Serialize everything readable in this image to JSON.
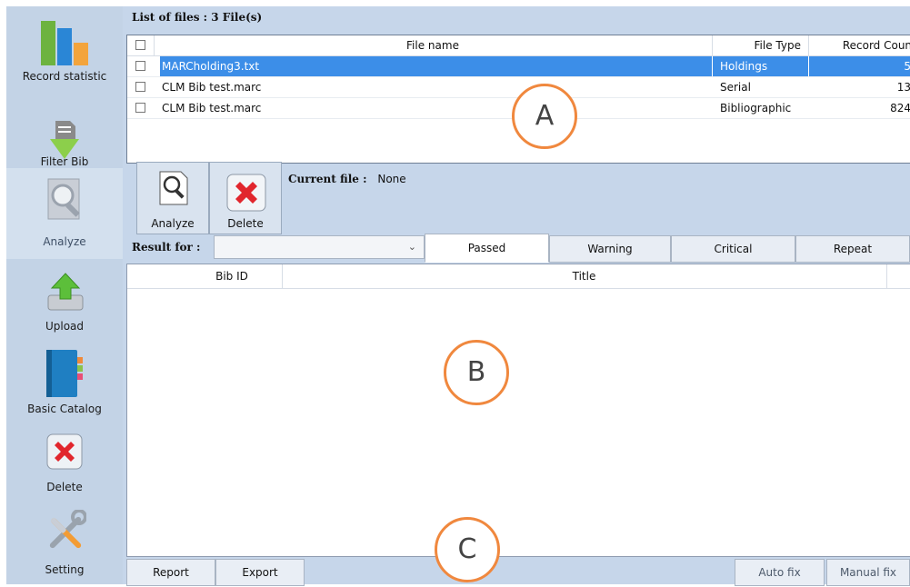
{
  "sidebar": {
    "items": [
      {
        "label": "Record statistic",
        "icon": "bar-chart-icon"
      },
      {
        "label": "Filter Bib",
        "icon": "filter-download-icon"
      },
      {
        "label": "Analyze",
        "icon": "magnifier-icon"
      },
      {
        "label": "Upload",
        "icon": "upload-icon"
      },
      {
        "label": "Basic Catalog",
        "icon": "catalog-book-icon"
      },
      {
        "label": "Delete",
        "icon": "red-x-icon"
      },
      {
        "label": "Setting",
        "icon": "tools-icon"
      }
    ],
    "active": "Analyze"
  },
  "files": {
    "title": "List of files : 3 File(s)",
    "columns": [
      "File name",
      "File Type",
      "Record Counts"
    ],
    "rows": [
      {
        "name": "MARCholding3.txt",
        "type": "Holdings",
        "count": "5",
        "selected": true
      },
      {
        "name": "CLM Bib test.marc",
        "type": "Serial",
        "count": "13",
        "selected": false
      },
      {
        "name": "CLM Bib test.marc",
        "type": "Bibliographic",
        "count": "824",
        "selected": false
      }
    ]
  },
  "toolbar": {
    "analyze_label": "Analyze",
    "delete_label": "Delete",
    "current_file_label": "Current file :",
    "current_file_value": "None"
  },
  "result": {
    "label": "Result for :",
    "selected": "",
    "tabs": [
      "Passed",
      "Warning",
      "Critical",
      "Repeat"
    ],
    "active_tab": "Passed",
    "columns": [
      "Bib ID",
      "Title"
    ]
  },
  "bottom": {
    "report_label": "Report",
    "export_label": "Export",
    "auto_fix_label": "Auto fix",
    "manual_fix_label": "Manual fix"
  },
  "markers": [
    "A",
    "B",
    "C"
  ],
  "colors": {
    "accent_orange": "#f0883e",
    "selection_blue": "#3c8ee8",
    "panel_blue": "#c6d6ea"
  }
}
